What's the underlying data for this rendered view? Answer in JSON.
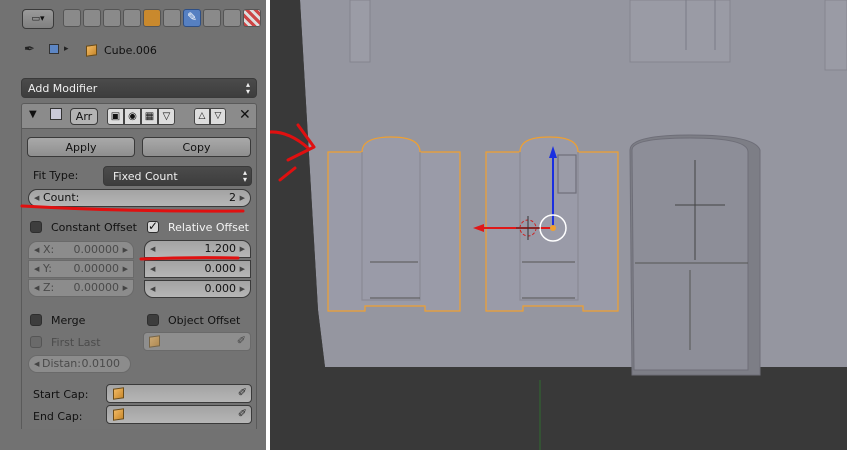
{
  "object": {
    "name": "Cube.006"
  },
  "add_modifier": {
    "label": "Add Modifier"
  },
  "modifier": {
    "name": "Arr",
    "apply_label": "Apply",
    "copy_label": "Copy",
    "fit_type": {
      "label": "Fit Type:",
      "value": "Fixed Count"
    },
    "count": {
      "label": "Count:",
      "value": "2"
    },
    "constant_offset": {
      "label": "Constant Offset",
      "checked": false,
      "x": {
        "label": "X:",
        "value": "0.00000"
      },
      "y": {
        "label": "Y:",
        "value": "0.00000"
      },
      "z": {
        "label": "Z:",
        "value": "0.00000"
      }
    },
    "relative_offset": {
      "label": "Relative Offset",
      "checked": true,
      "x": "1.200",
      "y": "0.000",
      "z": "0.000"
    },
    "merge": {
      "label": "Merge",
      "checked": false
    },
    "first_last": {
      "label": "First Last",
      "checked": false
    },
    "distance": {
      "label": "Distan:",
      "value": "0.0100"
    },
    "object_offset": {
      "label": "Object Offset",
      "checked": false
    },
    "start_cap": {
      "label": "Start Cap:"
    },
    "end_cap": {
      "label": "End Cap:"
    }
  },
  "colors": {
    "panel_bg": "#727272",
    "viewport_bg": "#393939",
    "wall": "#9696a0",
    "selection": "#f0a030",
    "annotation": "#e01010",
    "active_tab": "#5680c2"
  },
  "icons": [
    "pin-icon",
    "cube-icon",
    "wrench-icon",
    "eye-icon",
    "camera-icon",
    "eyedropper-icon"
  ]
}
